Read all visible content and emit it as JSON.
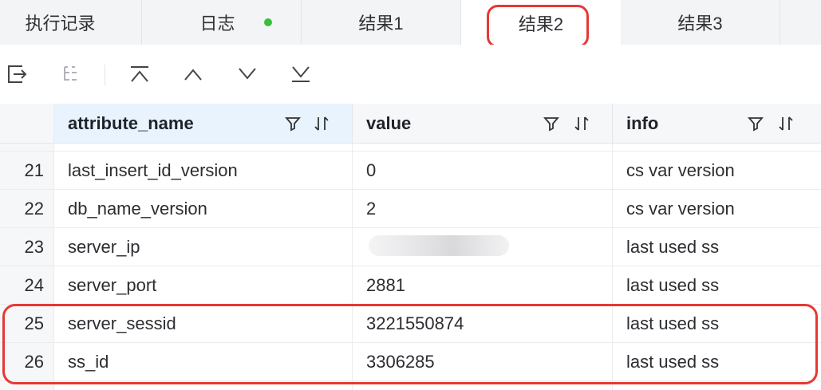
{
  "tabs": [
    {
      "label": "执行记录"
    },
    {
      "label": "日志"
    },
    {
      "label": "结果1"
    },
    {
      "label": "结果2"
    },
    {
      "label": "结果3"
    }
  ],
  "colors": {
    "log_dot": "#3bbf3b",
    "highlight": "#e53935",
    "header_active_bg": "#e8f3fd"
  },
  "toolbar": {
    "icons": [
      "export-icon",
      "tree-icon",
      "first-row-icon",
      "previous-row-icon",
      "next-row-icon",
      "last-row-icon"
    ]
  },
  "table": {
    "columns": [
      "attribute_name",
      "value",
      "info"
    ],
    "rows": [
      {
        "num": "21",
        "attribute_name": "last_insert_id_version",
        "value": "0",
        "info": "cs var version"
      },
      {
        "num": "22",
        "attribute_name": "db_name_version",
        "value": "2",
        "info": "cs var version"
      },
      {
        "num": "23",
        "attribute_name": "server_ip",
        "value": "",
        "info": "last used ss"
      },
      {
        "num": "24",
        "attribute_name": "server_port",
        "value": "2881",
        "info": "last used ss"
      },
      {
        "num": "25",
        "attribute_name": "server_sessid",
        "value": "3221550874",
        "info": "last used ss"
      },
      {
        "num": "26",
        "attribute_name": "ss_id",
        "value": "3306285",
        "info": "last used ss"
      }
    ]
  }
}
